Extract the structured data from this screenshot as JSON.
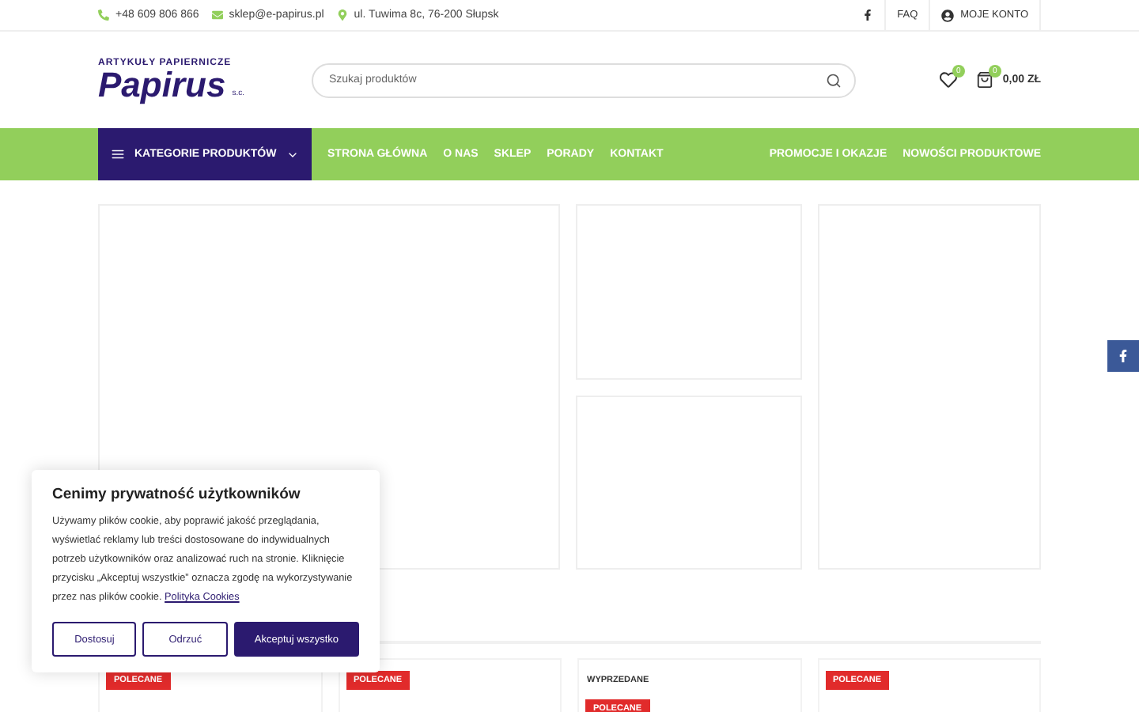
{
  "top_bar": {
    "contacts": [
      {
        "kind": "phone",
        "text": "+48 609 806 866"
      },
      {
        "kind": "mail",
        "text": "sklep@e-papirus.pl"
      },
      {
        "kind": "address",
        "text": "ul. Tuwima 8c, 76-200 Słupsk"
      }
    ],
    "links": [
      "FAQ",
      "MOJE KONTO"
    ]
  },
  "header": {
    "logo": {
      "tagline": "ARTYKUŁY PAPIERNICZE",
      "name": "Papirus",
      "suffix": "s.c."
    },
    "search": {
      "placeholder": "Szukaj produktów"
    },
    "wishlist_count": "0",
    "cart_count": "0",
    "cart_total": "0,00 ZŁ"
  },
  "nav": {
    "categories": "KATEGORIE PRODUKTÓW",
    "items": [
      "STRONA GŁÓWNA",
      "O NAS",
      "SKLEP",
      "PORADY",
      "KONTAKT"
    ],
    "right_items": [
      "PROMOCJE I OKAZJE",
      "NOWOŚCI PRODUKTOWE"
    ]
  },
  "products": [
    {
      "badges": [
        {
          "kind": "tag",
          "text": "POLECANE"
        }
      ]
    },
    {
      "badges": [
        {
          "kind": "tag",
          "text": "POLECANE"
        }
      ]
    },
    {
      "badges": [
        {
          "kind": "label",
          "text": "WYPRZEDANE"
        },
        {
          "kind": "tag",
          "text": "POLECANE"
        }
      ]
    },
    {
      "badges": [
        {
          "kind": "tag",
          "text": "POLECANE"
        }
      ]
    }
  ],
  "cookie_popup": {
    "title": "Cenimy prywatność użytkowników",
    "text": "Używamy plików cookie, aby poprawić jakość przeglądania, wyświetlać reklamy lub treści dostosowane do indywidualnych potrzeb użytkowników oraz analizować ruch na stronie. Kliknięcie przycisku „Akceptuj wszystkie” oznacza zgodę na wykorzystywanie przez nas plików cookie.",
    "link": "Polityka Cookies",
    "buttons": [
      {
        "label": "Dostosuj",
        "primary": false
      },
      {
        "label": "Odrzuć",
        "primary": false
      },
      {
        "label": "Akceptuj wszystko",
        "primary": true
      }
    ]
  }
}
